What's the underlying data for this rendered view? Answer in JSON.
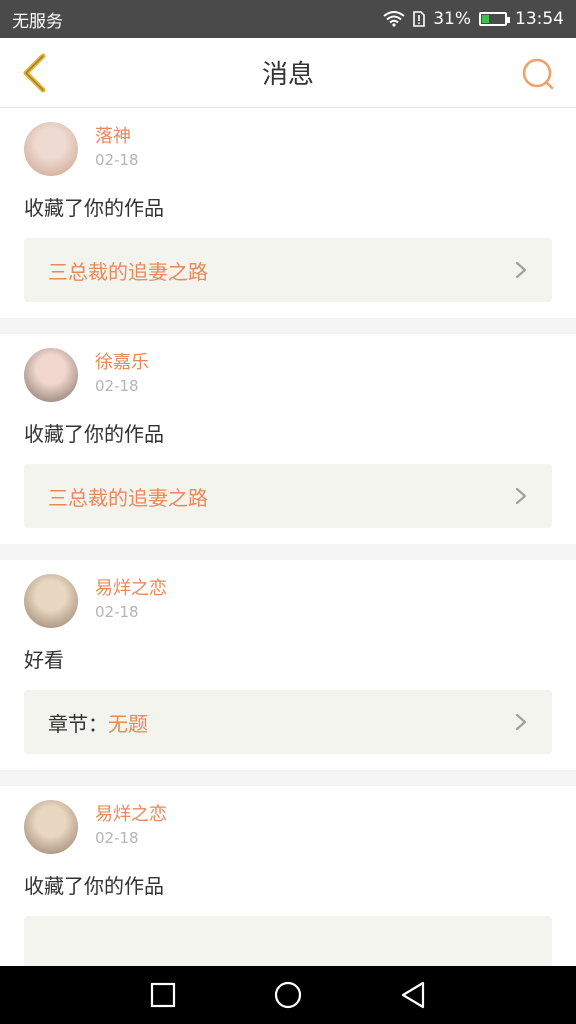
{
  "status_bar": {
    "carrier": "无服务",
    "battery_percent": "31%",
    "time": "13:54",
    "battery_level": 0.31,
    "battery_color": "#3fbf4c"
  },
  "header": {
    "title": "消息",
    "accent_color": "#e8895a",
    "back_icon": "chevron-left-icon",
    "search_icon": "search-icon"
  },
  "messages": [
    {
      "username": "落神",
      "date": "02-18",
      "action": "收藏了你的作品",
      "work_prefix": "",
      "work_title": "三总裁的追妻之路",
      "avatar_colors": [
        "#c9a08a",
        "#eedad0"
      ]
    },
    {
      "username": "徐嘉乐",
      "date": "02-18",
      "action": "收藏了你的作品",
      "work_prefix": "",
      "work_title": "三总裁的追妻之路",
      "avatar_colors": [
        "#7a6a62",
        "#f0d6cc"
      ]
    },
    {
      "username": "易烊之恋",
      "date": "02-18",
      "action": "好看",
      "work_prefix": "章节：",
      "work_title": "无题",
      "avatar_colors": [
        "#8f7965",
        "#e9d7c2"
      ]
    },
    {
      "username": "易烊之恋",
      "date": "02-18",
      "action": "收藏了你的作品",
      "work_prefix": "",
      "work_title": "",
      "avatar_colors": [
        "#8f7965",
        "#e9d7c2"
      ]
    }
  ],
  "nav_bar": {
    "recent_icon": "square-icon",
    "home_icon": "circle-icon",
    "back_icon": "triangle-back-icon"
  }
}
